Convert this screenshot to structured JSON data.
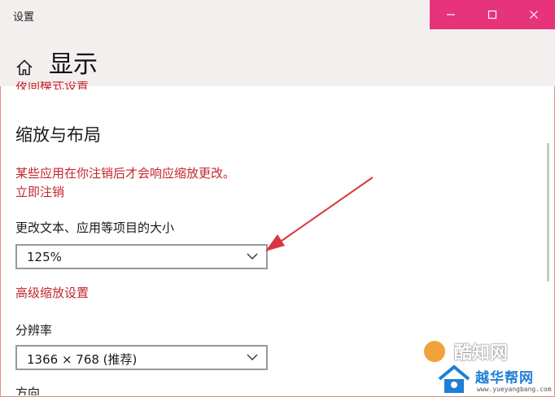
{
  "window": {
    "title": "设置"
  },
  "header": {
    "title": "显示"
  },
  "night_light_link": "夜间模式设置",
  "scale_section": {
    "title": "缩放与布局",
    "warning": "某些应用在你注销后才会响应缩放更改。",
    "signout_link": "立即注销",
    "size_label": "更改文本、应用等项目的大小",
    "size_value": "125%",
    "advanced_link": "高级缩放设置",
    "resolution_label": "分辨率",
    "resolution_value": "1366 × 768 (推荐)",
    "orientation_label": "方向"
  },
  "watermarks": {
    "brand1": "酷知网",
    "brand2": "越华帮网",
    "brand2_url": "www.yueyangbang.com"
  },
  "colors": {
    "accent_red": "#c4262e",
    "titlebar_controls": "#e6337a",
    "annotation_arrow": "#d8373f"
  }
}
